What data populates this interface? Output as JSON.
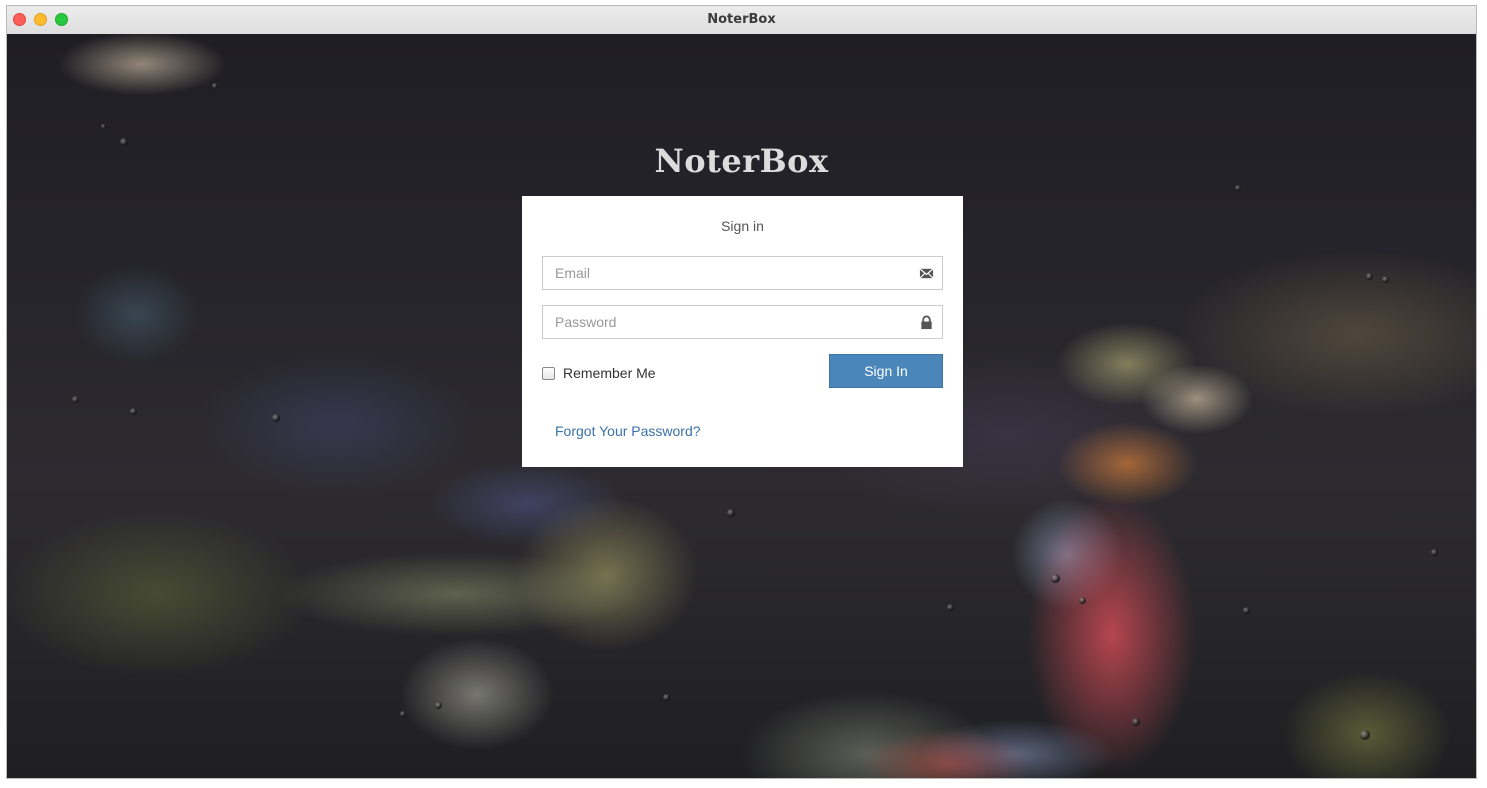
{
  "window": {
    "title": "NoterBox"
  },
  "brand": {
    "name": "NoterBox"
  },
  "signin": {
    "title": "Sign in",
    "email_placeholder": "Email",
    "email_value": "",
    "email_icon": "envelope-icon",
    "password_placeholder": "Password",
    "password_value": "",
    "password_icon": "lock-icon",
    "remember_label": "Remember Me",
    "remember_checked": false,
    "submit_label": "Sign In",
    "forgot_label": "Forgot Your Password?"
  },
  "colors": {
    "accent": "#4a86ba",
    "link": "#3b72a8"
  }
}
